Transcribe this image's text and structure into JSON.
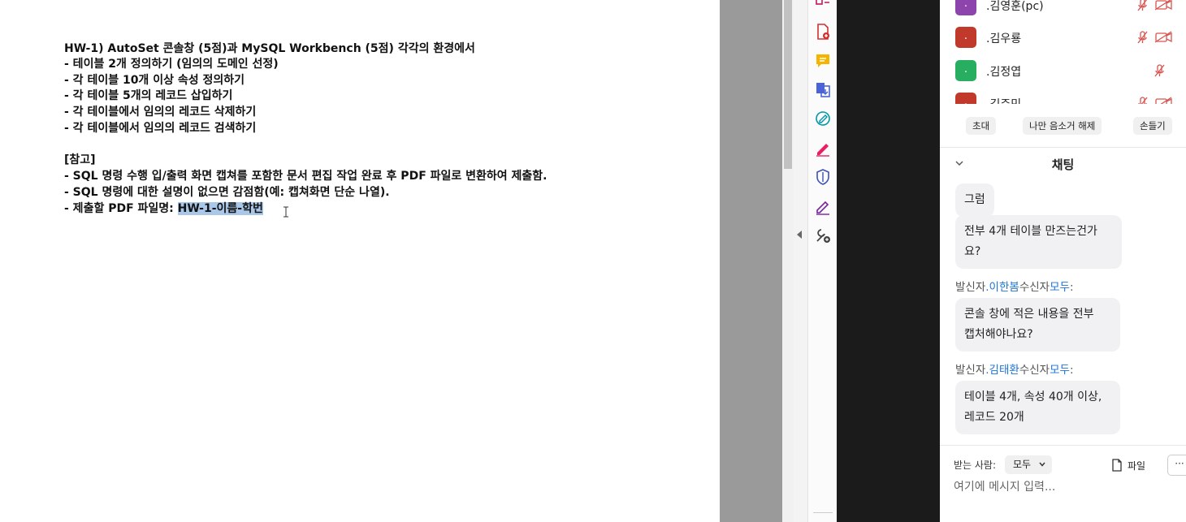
{
  "document": {
    "lines": [
      "HW-1) AutoSet 콘솔창 (5점)과 MySQL Workbench (5점) 각각의 환경에서",
      "- 테이블 2개 정의하기 (임의의 도메인 선정)",
      "- 각 테이블 10개 이상 속성 정의하기",
      "- 각 테이블 5개의 레코드 삽입하기",
      "- 각 테이블에서 임의의 레코드 삭제하기",
      "- 각 테이블에서 임의의 레코드 검색하기",
      "[참고]",
      "- SQL 명령 수행 입/출력 화면 캡쳐를 포함한 문서 편집 작업 완료 후 PDF 파일로 변환하여 제출함.",
      "- SQL 명령에 대한 설명이 없으면 감점함(예: 캡쳐화면 단순 나열)."
    ],
    "filename_prefix": "- 제출할 PDF 파일명: ",
    "filename_highlight": "HW-1-이름-학번"
  },
  "participants": [
    {
      "initial": ".",
      "name": ".김영훈(pc)",
      "color": "#8e44ad",
      "mic_muted": true,
      "video_off": true
    },
    {
      "initial": ".",
      "name": ".김우룡",
      "color": "#c0392b",
      "mic_muted": true,
      "video_off": true
    },
    {
      "initial": ".",
      "name": ".김정엽",
      "color": "#27ae60",
      "mic_muted": true,
      "video_off": false
    },
    {
      "initial": ".",
      "name": ".김주민",
      "color": "#c0392b",
      "mic_muted": true,
      "video_off": true
    }
  ],
  "participant_actions": {
    "invite": "초대",
    "unmute_me": "나만 음소거 해제",
    "raise_hand": "손들기"
  },
  "chat": {
    "title": "채팅",
    "sender_prefix": "발신자",
    "recipient_label": "수신자",
    "messages": [
      {
        "type": "bubble",
        "text": "그럼"
      },
      {
        "type": "bubble",
        "lines": [
          "전부 4개 테이블 만즈는건가",
          "요?"
        ]
      },
      {
        "type": "sender",
        "from": ".이한봄",
        "to": "모두"
      },
      {
        "type": "bubble",
        "lines": [
          "콘솔 창에 적은 내용을 전부",
          "캡처해야나요?"
        ]
      },
      {
        "type": "sender",
        "from": ".김태환",
        "to": "모두"
      },
      {
        "type": "bubble",
        "lines": [
          "테이블 4개, 속성 40개 이상,",
          "레코드 20개"
        ]
      }
    ],
    "to_label": "받는 사람:",
    "to_value": "모두",
    "file_label": "파일",
    "more_label": "···",
    "input_placeholder": "여기에 메시지 입력..."
  },
  "colors": {
    "link": "#1a73d8",
    "bubble_bg": "#f1f1f4",
    "highlight": "#a9c7e8"
  }
}
